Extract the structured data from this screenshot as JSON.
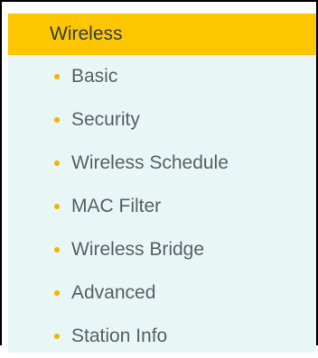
{
  "menu": {
    "header_label": "Wireless",
    "items": [
      {
        "label": "Basic",
        "bullet_icon": "bullet-dot-icon"
      },
      {
        "label": "Security",
        "bullet_icon": "bullet-dot-icon"
      },
      {
        "label": "Wireless Schedule",
        "bullet_icon": "bullet-dot-icon"
      },
      {
        "label": "MAC Filter",
        "bullet_icon": "bullet-dot-icon"
      },
      {
        "label": "Wireless Bridge",
        "bullet_icon": "bullet-dot-icon"
      },
      {
        "label": "Advanced",
        "bullet_icon": "bullet-dot-icon"
      },
      {
        "label": "Station Info",
        "bullet_icon": "bullet-dot-icon"
      }
    ]
  },
  "colors": {
    "header_bg": "#fec601",
    "submenu_bg": "#e8f6f6",
    "bullet": "#f5b400",
    "text": "#5a5f66"
  }
}
